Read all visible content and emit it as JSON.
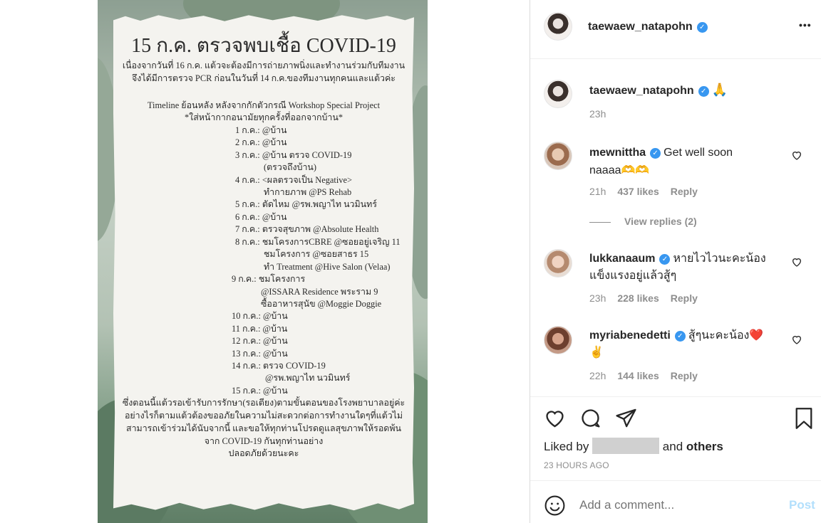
{
  "post_image": {
    "title": "15 ก.ค. ตรวจพบเชื้อ COVID-19",
    "intro": [
      "เนื่องจากวันที่ 16 ก.ค. แต้วจะต้องมีการถ่ายภาพนิ่งและทำงานร่วมกับทีมงาน",
      "จึงได้มีการตรวจ PCR ก่อนในวันที่ 14 ก.ค.ของทีมงานทุกคนและแต้วค่ะ"
    ],
    "timeline_heading": [
      "Timeline ย้อนหลัง หลังจากกักตัวกรณี Workshop Special Project",
      "*ใส่หน้ากากอนามัยทุกครั้งที่ออกจากบ้าน*"
    ],
    "timeline": [
      "1 ก.ค.: @บ้าน",
      "2 ก.ค.: @บ้าน",
      "3 ก.ค.: @บ้าน ตรวจ COVID-19",
      "(ตรวจถึงบ้าน)",
      "4 ก.ค.: <ผลตรวจเป็น Negative>",
      "ทำกายภาพ @PS Rehab",
      "5 ก.ค.: ตัดไหม @รพ.พญาไท นวมินทร์",
      "6 ก.ค.: @บ้าน",
      "7 ก.ค.: ตรวจสุขภาพ @Absolute Health",
      "8 ก.ค.: ชมโครงการCBRE @ซอยอยู่เจริญ 11",
      "ชมโครงการ @ซอยสาธร 15",
      "ทำ Treatment @Hive Salon (Velaa)",
      "9 ก.ค.: ชมโครงการ",
      "@ISSARA Residence พระราม 9",
      "ซื้ออาหารสุนัข @Moggie Doggie",
      "10 ก.ค.: @บ้าน",
      "11 ก.ค.: @บ้าน",
      "12 ก.ค.: @บ้าน",
      "13 ก.ค.: @บ้าน",
      "14 ก.ค.: ตรวจ COVID-19",
      "@รพ.พญาไท นวมินทร์",
      "15 ก.ค.: @บ้าน"
    ],
    "closing": [
      "ซึ่งตอนนี้แต้วรอเข้ารับการรักษา(รอเตียง)ตามขั้นตอนของโรงพยาบาลอยู่ค่ะ",
      "อย่างไรก็ตามแต้วต้องขออภัยในความไม่สะดวกต่อการทำงานใดๆที่แต้วไม่",
      "สามารถเข้าร่วมได้นับจากนี้ และขอให้ทุกท่านโปรดดูแลสุขภาพให้รอดพ้น",
      "จาก COVID-19 กันทุกท่านอย่าง",
      "ปลอดภัยด้วยนะคะ"
    ]
  },
  "header": {
    "username": "taewaew_natapohn",
    "more_label": "•••"
  },
  "caption": {
    "username": "taewaew_natapohn",
    "text": "🙏",
    "time": "23h"
  },
  "comments": [
    {
      "username": "mewnittha",
      "text": "Get well soon",
      "text2": "naaaa🫶🫶",
      "time": "21h",
      "likes": "437 likes",
      "reply": "Reply"
    },
    {
      "username": "lukkanaaum",
      "text": "หายไวไวนะคะน้อง",
      "text2": "แข็งแรงอยู่แล้วสู้ๆ",
      "time": "23h",
      "likes": "228 likes",
      "reply": "Reply"
    },
    {
      "username": "myriabenedetti",
      "text": "สู้ๆนะคะน้อง❤️",
      "text2": "✌️",
      "time": "22h",
      "likes": "144 likes",
      "reply": "Reply"
    }
  ],
  "view_replies": "View replies (2)",
  "likes_line": {
    "prefix": "Liked by",
    "middle": "and",
    "suffix": "others"
  },
  "post_time": "23 HOURS AGO",
  "comment_box": {
    "placeholder": "Add a comment...",
    "post_label": "Post"
  },
  "colors": {
    "verified": "#3897f0",
    "post_button": "#b2dffc",
    "meta": "#8e8e8e"
  }
}
